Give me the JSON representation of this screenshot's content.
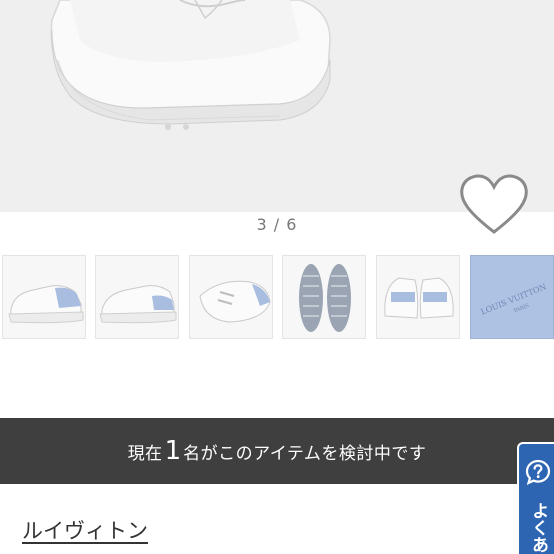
{
  "gallery": {
    "counter": "3 / 6",
    "thumbnails": [
      {
        "name": "sneaker-side-view-1"
      },
      {
        "name": "sneaker-side-view-2"
      },
      {
        "name": "sneaker-top-view"
      },
      {
        "name": "sneaker-soles"
      },
      {
        "name": "sneaker-heels"
      },
      {
        "name": "shoe-bag"
      }
    ],
    "bag_text": "LOUIS VUITTON",
    "bag_sub": "PARIS"
  },
  "favorite": {
    "icon": "heart-icon"
  },
  "banner": {
    "prefix": "現在",
    "count": "1",
    "suffix": "名がこのアイテムを検討中です"
  },
  "help": {
    "icon": "question-icon",
    "label": "よくあ"
  },
  "brand": {
    "name": "ルイヴィトン"
  },
  "colors": {
    "banner_bg": "#3f3f3f",
    "help_bg": "#2e65b3",
    "accent_blue": "#a8bde0"
  }
}
